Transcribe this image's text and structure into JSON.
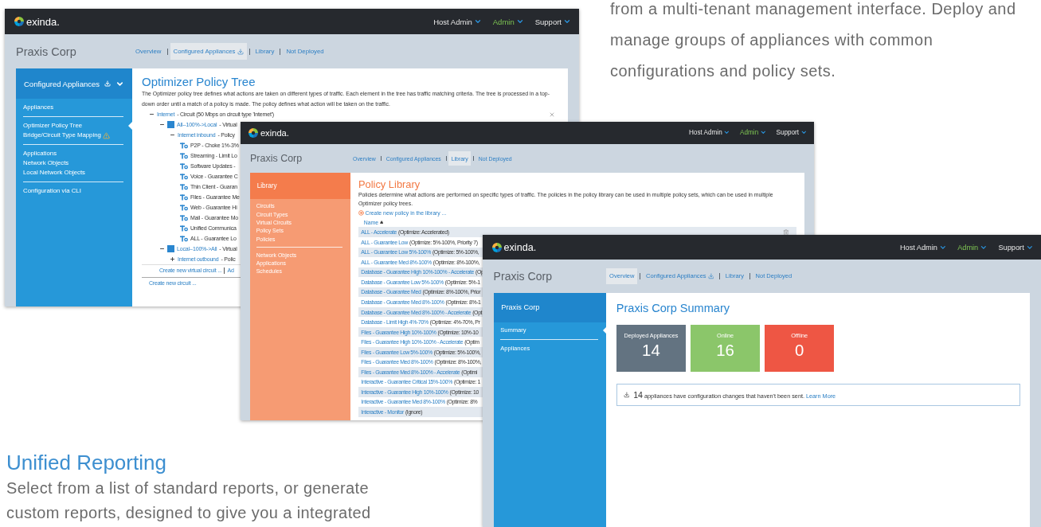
{
  "intro": {
    "text": "from a multi-tenant management interface. Deploy and manage groups of appliances with common configurations and policy sets."
  },
  "section": {
    "heading": "Unified Reporting",
    "text": "Select from a list of standard reports, or generate custom reports, designed to give you a integrated"
  },
  "windows": [
    {
      "kind": "tree",
      "brand": "exinda.",
      "nav": [
        {
          "label": "Host Admin",
          "selected": false
        },
        {
          "label": "Admin",
          "selected": true
        },
        {
          "label": "Support",
          "selected": false
        }
      ],
      "org": "Praxis Corp",
      "tabs": [
        {
          "label": "Overview",
          "selected": false,
          "download": false
        },
        {
          "label": "Configured Appliances",
          "selected": true,
          "download": true
        },
        {
          "label": "Library",
          "selected": false,
          "download": false
        },
        {
          "label": "Not Deployed",
          "selected": false,
          "download": false
        }
      ],
      "sidebar": {
        "kind": "blue",
        "title": "Configured Appliances",
        "actions": true,
        "groups": [
          [
            {
              "label": "Appliances",
              "selected": false,
              "warning": false
            }
          ],
          [
            {
              "label": "Optimizer Policy Tree",
              "selected": true,
              "warning": false
            },
            {
              "label": "Bridge/Circuit Type Mapping",
              "selected": false,
              "warning": true
            }
          ],
          [
            {
              "label": "Applications",
              "selected": false,
              "warning": false
            },
            {
              "label": "Network Objects",
              "selected": false,
              "warning": false
            },
            {
              "label": "Local Network Objects",
              "selected": false,
              "warning": false
            }
          ],
          [
            {
              "label": "Configuration via CLI",
              "selected": false,
              "warning": false
            }
          ]
        ]
      },
      "content": {
        "title": "Optimizer Policy Tree",
        "description": "The Optimizer policy tree defines what actions are taken on different types of traffic. Each element in the tree has traffic matching criteria. The tree is processed in a top-down order until a match of a policy is made. The policy defines what action will be taken on the traffic.",
        "tree": [
          {
            "kind": "circuit",
            "name": "Internet",
            "detail": "- Circuit (50 Mbps on circuit type 'Internet')",
            "expanded": true,
            "children": [
              {
                "kind": "virtual",
                "name": "All--100%->Local",
                "detail": "- Virtual",
                "expanded": true,
                "children": [
                  {
                    "kind": "policyset",
                    "name": "Internet inbound",
                    "detail": "- Policy",
                    "expanded": true,
                    "children": [
                      {
                        "kind": "policy",
                        "name": "P2P - Choke 1%-3%"
                      },
                      {
                        "kind": "policy",
                        "name": "Streaming - Limit Lo"
                      },
                      {
                        "kind": "policy",
                        "name": "Software Updates -"
                      },
                      {
                        "kind": "policy",
                        "name": "Voice - Guarantee C"
                      },
                      {
                        "kind": "policy",
                        "name": "Thin Client - Guaran"
                      },
                      {
                        "kind": "policy",
                        "name": "Files - Guarantee Me"
                      },
                      {
                        "kind": "policy",
                        "name": "Web - Guarantee Hi"
                      },
                      {
                        "kind": "policy",
                        "name": "Mail - Guarantee Mo"
                      },
                      {
                        "kind": "policy",
                        "name": "Unified Communica"
                      },
                      {
                        "kind": "policy",
                        "name": "ALL - Guarantee Lo"
                      }
                    ]
                  }
                ]
              },
              {
                "kind": "virtual",
                "name": "Local--100%->All",
                "detail": "- Virtual",
                "expanded": true,
                "children": [
                  {
                    "kind": "policyset",
                    "name": "Internet outbound",
                    "detail": "- Polic",
                    "expanded": false
                  }
                ]
              }
            ],
            "links": [
              "Create new virtual circuit ...",
              "Ad"
            ]
          }
        ],
        "footer_link": "Create new circuit ..."
      }
    },
    {
      "kind": "library",
      "brand": "exinda.",
      "nav": [
        {
          "label": "Host Admin",
          "selected": false
        },
        {
          "label": "Admin",
          "selected": true
        },
        {
          "label": "Support",
          "selected": false
        }
      ],
      "org": "Praxis Corp",
      "tabs": [
        {
          "label": "Overview",
          "selected": false,
          "download": false
        },
        {
          "label": "Configured Appliances",
          "selected": false,
          "download": false
        },
        {
          "label": "Library",
          "selected": true,
          "download": false
        },
        {
          "label": "Not Deployed",
          "selected": false,
          "download": false
        }
      ],
      "sidebar": {
        "kind": "orange",
        "title": "Library",
        "actions": false,
        "groups": [
          [
            {
              "label": "Circuits",
              "selected": false,
              "warning": false
            },
            {
              "label": "Circuit Types",
              "selected": false,
              "warning": false
            },
            {
              "label": "Virtual Circuits",
              "selected": false,
              "warning": false
            },
            {
              "label": "Policy Sets",
              "selected": false,
              "warning": false
            },
            {
              "label": "Policies",
              "selected": false,
              "warning": false
            }
          ],
          [
            {
              "label": "Network Objects",
              "selected": false,
              "warning": false
            },
            {
              "label": "Applications",
              "selected": false,
              "warning": false
            },
            {
              "label": "Schedules",
              "selected": false,
              "warning": false
            }
          ]
        ]
      },
      "content": {
        "title": "Policy Library",
        "description": "Policies determine what actions are performed on specific types of traffic. The policies in the policy library can be used in multiple policy sets, which can be used in multiple Optimizer policy trees.",
        "create_link": "Create new policy in the library ...",
        "column": {
          "label": "Name",
          "ascending": true
        },
        "rows": [
          {
            "name": "ALL - Accelerate",
            "detail": "(Optimize: Accelerated)"
          },
          {
            "name": "ALL - Guarantee Low",
            "detail": "(Optimize: 5%-100%, Priority 7)"
          },
          {
            "name": "ALL - Guarantee Low 5%-100%",
            "detail": "(Optimize: 5%-100%,"
          },
          {
            "name": "ALL - Guarantee Med 8%-100%",
            "detail": "(Optimize: 8%-100%,"
          },
          {
            "name": "Database - Guarantee High 10%-100% - Accelerate",
            "detail": "(Op"
          },
          {
            "name": "Database - Guarantee Low 5%-100%",
            "detail": "(Optimize: 5%-1"
          },
          {
            "name": "Database - Guarantee Med",
            "detail": "(Optimize: 8%-100%, Prior"
          },
          {
            "name": "Database - Guarantee Med 8%-100%",
            "detail": "(Optimize: 8%-1"
          },
          {
            "name": "Database - Guarantee Med 8%-100% - Accelerate",
            "detail": "(Opt"
          },
          {
            "name": "Database - Limit High 4%-70%",
            "detail": "(Optimize: 4%-70%, Pr"
          },
          {
            "name": "Files - Guarantee High 10%-100%",
            "detail": "(Optimize: 10%-10"
          },
          {
            "name": "Files - Guarantee High 10%-100% - Accelerate",
            "detail": "(Optim"
          },
          {
            "name": "Files - Guarantee Low 5%-100%",
            "detail": "(Optimize: 5%-100%,"
          },
          {
            "name": "Files - Guarantee Med 8%-100%",
            "detail": "(Optimize: 8%-100%,"
          },
          {
            "name": "Files - Guarantee Med 8%-100% - Accelerate",
            "detail": "(Optimi"
          },
          {
            "name": "Interactive - Guarantee Critical 15%-100%",
            "detail": "(Optimize: 1"
          },
          {
            "name": "Interactive - Guarantee High 10%-100%",
            "detail": "(Optimize: 10"
          },
          {
            "name": "Interactive - Guarantee Med 8%-100%",
            "detail": "(Optimize: 8%"
          },
          {
            "name": "Interactive - Monitor",
            "detail": "(Ignore)"
          }
        ]
      }
    },
    {
      "kind": "summary",
      "brand": "exinda.",
      "nav": [
        {
          "label": "Host Admin",
          "selected": false
        },
        {
          "label": "Admin",
          "selected": true
        },
        {
          "label": "Support",
          "selected": false
        }
      ],
      "org": "Praxis Corp",
      "tabs": [
        {
          "label": "Overview",
          "selected": true,
          "download": false
        },
        {
          "label": "Configured Appliances",
          "selected": false,
          "download": true
        },
        {
          "label": "Library",
          "selected": false,
          "download": false
        },
        {
          "label": "Not Deployed",
          "selected": false,
          "download": false
        }
      ],
      "sidebar": {
        "kind": "blue",
        "title": "Praxis Corp",
        "actions": false,
        "groups": [
          [
            {
              "label": "Summary",
              "selected": true,
              "warning": false
            }
          ],
          [
            {
              "label": "Appliances",
              "selected": false,
              "warning": false
            }
          ]
        ]
      },
      "content": {
        "title": "Praxis Corp Summary",
        "stats": [
          {
            "label": "Deployed Appliances",
            "value": "14",
            "color": "#637381"
          },
          {
            "label": "Online",
            "value": "16",
            "color": "#8bc66a"
          },
          {
            "label": "Offline",
            "value": "0",
            "color": "#ee5644"
          }
        ],
        "notice": {
          "count": "14",
          "text": "appliances have configuration changes that haven't been sent.",
          "link": "Learn More"
        }
      }
    }
  ]
}
